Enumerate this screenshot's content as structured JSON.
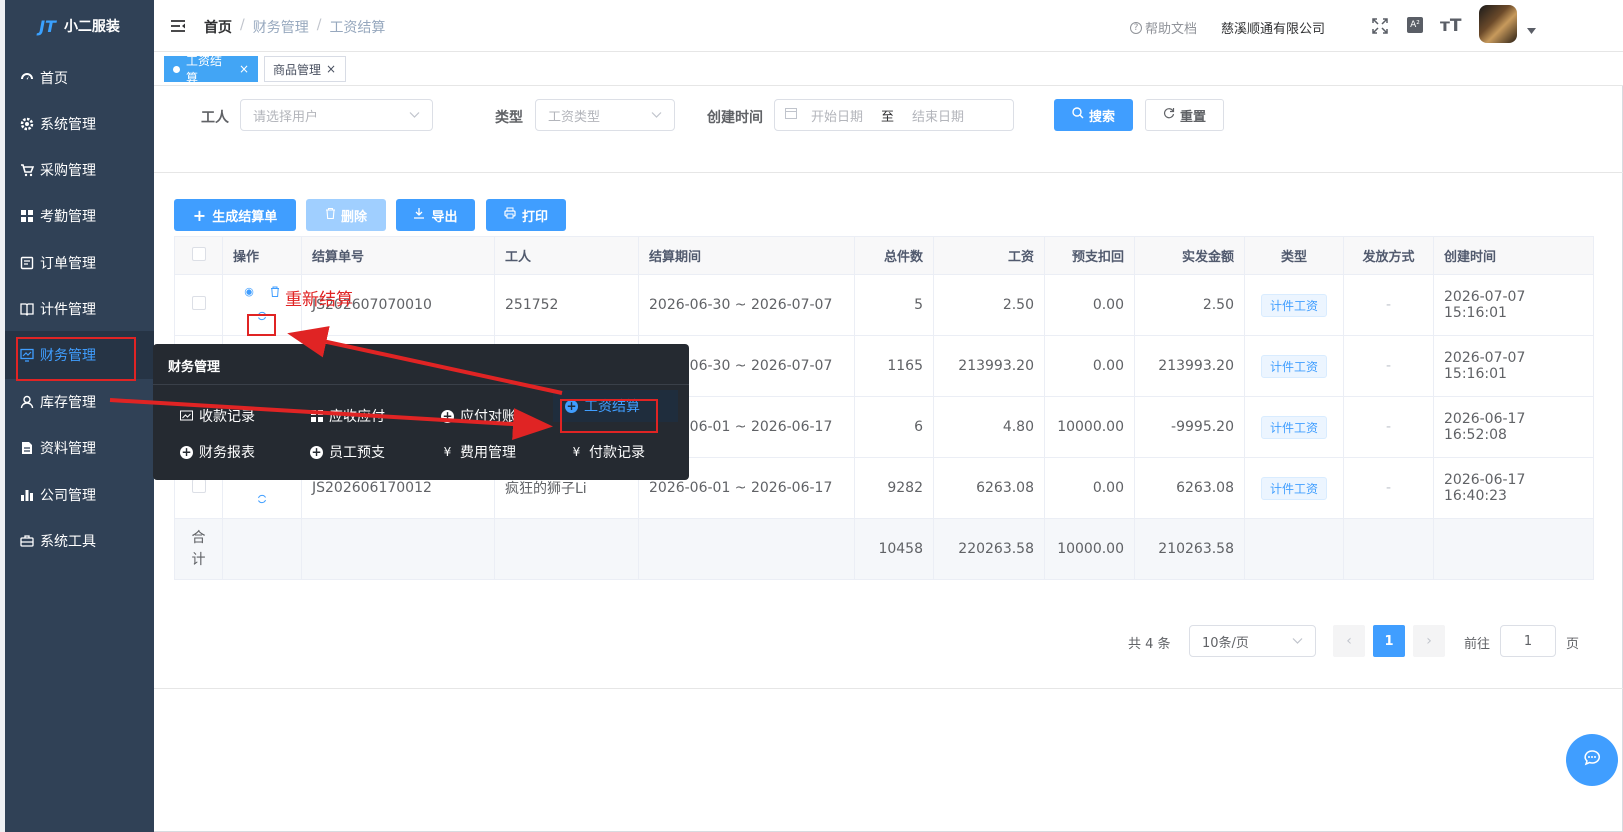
{
  "app": {
    "name": "小二服装",
    "logo_mark": "JT"
  },
  "sidebar": {
    "items": [
      {
        "label": "首页",
        "icon": "dashboard-icon"
      },
      {
        "label": "系统管理",
        "icon": "gear-icon"
      },
      {
        "label": "采购管理",
        "icon": "cart-icon"
      },
      {
        "label": "考勤管理",
        "icon": "grid-icon"
      },
      {
        "label": "订单管理",
        "icon": "order-icon"
      },
      {
        "label": "计件管理",
        "icon": "book-icon"
      },
      {
        "label": "财务管理",
        "icon": "chart-icon"
      },
      {
        "label": "库存管理",
        "icon": "user-icon"
      },
      {
        "label": "资料管理",
        "icon": "document-icon"
      },
      {
        "label": "公司管理",
        "icon": "bar-chart-icon"
      },
      {
        "label": "系统工具",
        "icon": "toolbox-icon"
      }
    ]
  },
  "header": {
    "breadcrumb": [
      "首页",
      "财务管理",
      "工资结算"
    ],
    "help": "帮助文档",
    "company": "慈溪顺通有限公司"
  },
  "tabs": [
    {
      "label": "工资结算",
      "active": true
    },
    {
      "label": "商品管理",
      "active": false
    }
  ],
  "search": {
    "worker_label": "工人",
    "worker_placeholder": "请选择用户",
    "type_label": "类型",
    "type_placeholder": "工资类型",
    "created_label": "创建时间",
    "start_placeholder": "开始日期",
    "to": "至",
    "end_placeholder": "结束日期",
    "search_btn": "搜索",
    "reset_btn": "重置"
  },
  "toolbar": {
    "generate": "生成结算单",
    "delete": "删除",
    "export": "导出",
    "print": "打印"
  },
  "table": {
    "headers": [
      "操作",
      "结算单号",
      "工人",
      "结算期间",
      "总件数",
      "工资",
      "预支扣回",
      "实发金额",
      "类型",
      "发放方式",
      "创建时间"
    ],
    "rows": [
      {
        "no": "JS202607070010",
        "worker": "251752",
        "period": "2026-06-30 ~ 2026-07-07",
        "qty": "5",
        "wage": "2.50",
        "advance": "0.00",
        "actual": "2.50",
        "type": "计件工资",
        "method": "-",
        "created": "2026-07-07 15:16:01"
      },
      {
        "no": "",
        "worker": "",
        "period": "2026-06-30 ~ 2026-07-07",
        "qty": "1165",
        "wage": "213993.20",
        "advance": "0.00",
        "actual": "213993.20",
        "type": "计件工资",
        "method": "-",
        "created": "2026-07-07 15:16:01"
      },
      {
        "no": "",
        "worker": "",
        "period": "2026-06-01 ~ 2026-06-17",
        "qty": "6",
        "wage": "4.80",
        "advance": "10000.00",
        "actual": "-9995.20",
        "type": "计件工资",
        "method": "-",
        "created": "2026-06-17 16:52:08"
      },
      {
        "no": "JS202606170012",
        "worker": "疯狂的狮子Li",
        "period": "2026-06-01 ~ 2026-06-17",
        "qty": "9282",
        "wage": "6263.08",
        "advance": "0.00",
        "actual": "6263.08",
        "type": "计件工资",
        "method": "-",
        "created": "2026-06-17 16:40:23"
      }
    ],
    "summary": {
      "label": "合计",
      "qty": "10458",
      "wage": "220263.58",
      "advance": "10000.00",
      "actual": "210263.58"
    }
  },
  "pagination": {
    "total": "共 4 条",
    "page_size": "10条/页",
    "current": "1",
    "goto": "前往",
    "goto_value": "1",
    "page_unit": "页"
  },
  "popup": {
    "title": "财务管理",
    "items": [
      "收款记录",
      "应收应付",
      "应付对账",
      "工资结算",
      "财务报表",
      "员工预支",
      "费用管理",
      "付款记录"
    ]
  },
  "annotation": {
    "text": "重新结算",
    "color": "#e02424"
  }
}
